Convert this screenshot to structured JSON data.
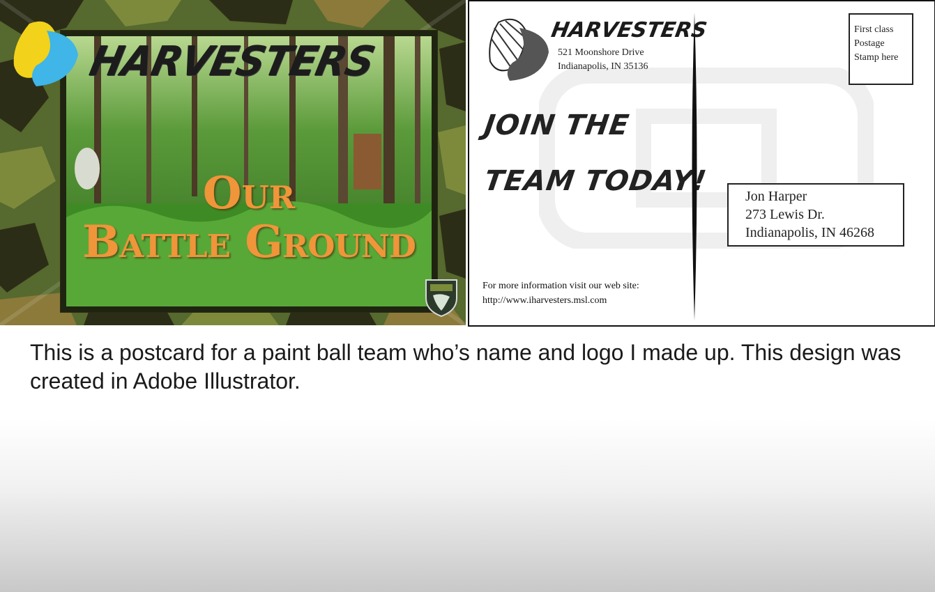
{
  "front": {
    "brand": "HARVESTERS",
    "title_line1": "Our",
    "title_line2": "Battle Ground",
    "colors": {
      "title": "#f0953a",
      "camo_dark": "#2a2a14",
      "camo_green": "#5f7a2e",
      "logo_yellow": "#f2d21a",
      "logo_blue": "#3fb5e8"
    },
    "icons": [
      "harvester-bug-logo-icon",
      "team-shield-icon"
    ]
  },
  "back": {
    "brand": "HARVESTERS",
    "return_address": [
      "521 Moonshore Drive",
      "Indianapolis, IN 35136"
    ],
    "slogan": [
      "JOIN THE",
      "TEAM TODAY!"
    ],
    "stamp": [
      "First class",
      "Postage",
      "Stamp here"
    ],
    "recipient": [
      "Jon Harper",
      "273  Lewis Dr.",
      "Indianapolis, IN 46268"
    ],
    "info": [
      "For more information visit our web site:",
      "http://www.iharvesters.msl.com"
    ]
  },
  "caption": "This is a postcard for a paint ball team who’s name and logo I made up.  This design was created in Adobe Illustrator."
}
